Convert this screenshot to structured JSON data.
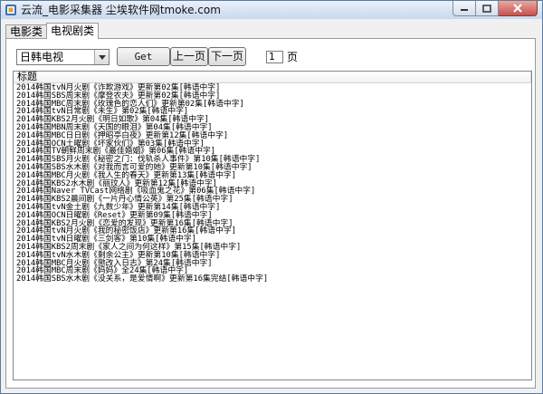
{
  "window": {
    "title": "云流_电影采集器 尘埃软件网tmoke.com"
  },
  "tabs": [
    {
      "label": "电影类"
    },
    {
      "label": "电视剧类"
    }
  ],
  "toolbar": {
    "category_value": "日韩电视",
    "get_label": "Get",
    "prev_label": "上一页",
    "next_label": "下一页",
    "page_value": "1",
    "page_unit": "页"
  },
  "list": {
    "header": "标题",
    "items": [
      "2014韩国tvN月火剧《诈欺游戏》更新第02集[韩语中字]",
      "2014韩国SBS周末剧《摩登农夫》更新第02集[韩语中字]",
      "2014韩国MBC周末剧《玫瑰色的恋人们》更新第02集[韩语中字]",
      "2014韩国tvN日常剧《未生》第02集[韩语中字]",
      "2014韩国KBS2月火剧《明日如歌》第04集[韩语中字]",
      "2014韩国MBN周末剧《天国的眼泪》第04集[韩语中字]",
      "2014韩国MBC日日剧《押昭亭白夜》更新第12集[韩语中字]",
      "2014韩国OCN土曜剧《坏家伙们》第03集[韩语中字]",
      "2014韩国TV朝鲜周末剧《最佳婚姻》第06集[韩语中字]",
      "2014韩国SBS月火剧《秘密之门：伐轨杀人事件》第10集[韩语中字]",
      "2014韩国SBS水木剧《对我而言可爱的她》更新第10集[韩语中字]",
      "2014韩国MBC月火剧《我人生的春天》更新第13集[韩语中字]",
      "2014韩国KBS2水木剧《丽玟人》更新第12集[韩语中字]",
      "2014韩国Naver TVCast网络剧《吸血鬼之花》第06集[韩语中字]",
      "2014韩国KBS2晨间剧《一片丹心情公英》第25集[韩语中字]",
      "2014韩国tvN金土剧《九数少年》更新第14集[韩语中字]",
      "2014韩国OCN日曜剧《Reset》更新第09集[韩语中字]",
      "2014韩国KBS2月火剧《恋爱的发现》更新第16集[韩语中字]",
      "2014韩国tvN月火剧《我的秘密饭店》更新第16集[韩语中字]",
      "2014韩国tvN日曜剧《三剑客》第10集[韩语中字]",
      "2014韩国KBS2周末剧《家人之间为何这样》第15集[韩语中字]",
      "2014韩国tvN水木剧《剩余公主》更新第10集[韩语中字]",
      "2014韩国MBC月火剧《懲改入日志》第24集[韩语中字]",
      "2014韩国MBC周末剧《妈妈》全24集[韩语中字]",
      "2014韩国SBS水木剧《没关系，是爱情啊》更新第16集完结[韩语中字]"
    ]
  }
}
